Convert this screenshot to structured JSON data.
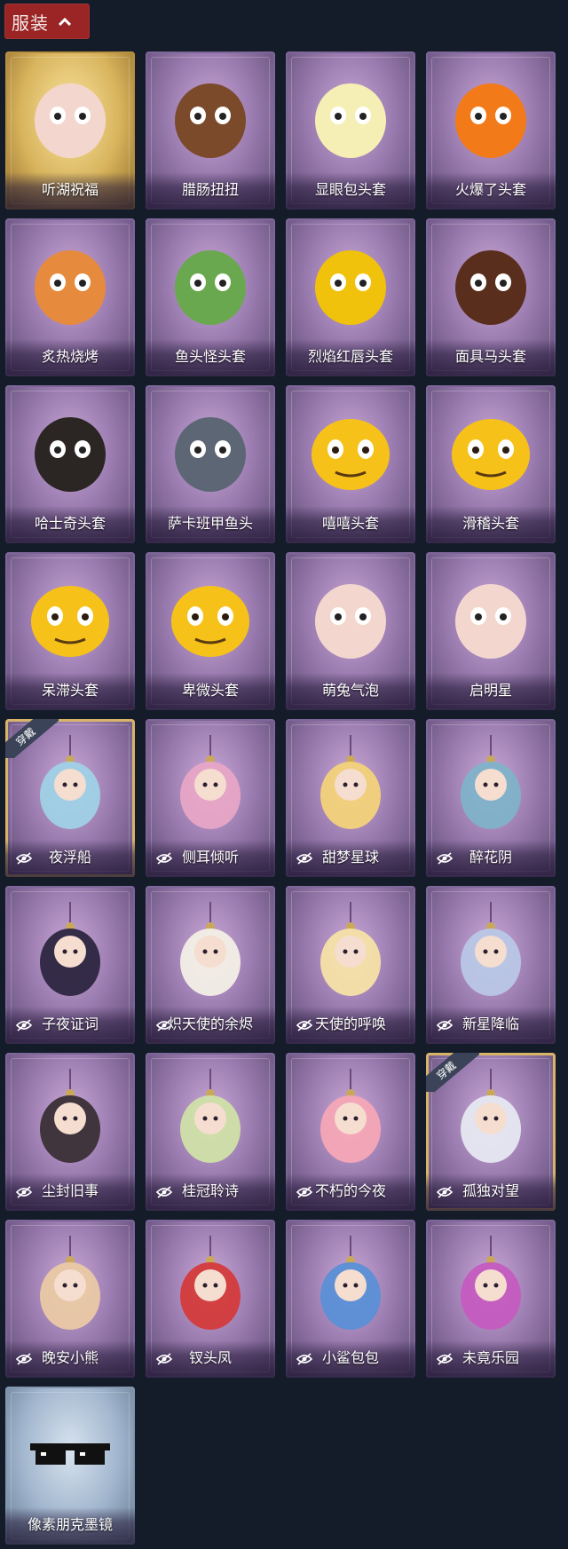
{
  "header": {
    "label": "服装"
  },
  "worn_label": "穿戴",
  "items": [
    {
      "name": "听湖祝福",
      "icon": "bald-doll-wings-icon",
      "frame": "gold",
      "hidden": false,
      "worn": false,
      "art_color": "#f3d7cf"
    },
    {
      "name": "腊肠扭扭",
      "icon": "dachshund-head-icon",
      "frame": "purple",
      "hidden": false,
      "worn": false,
      "art_color": "#7b4a2b"
    },
    {
      "name": "显眼包头套",
      "icon": "lightbulb-head-icon",
      "frame": "purple",
      "hidden": false,
      "worn": false,
      "art_color": "#f6efb5"
    },
    {
      "name": "火爆了头套",
      "icon": "fire-head-icon",
      "frame": "purple",
      "hidden": false,
      "worn": false,
      "art_color": "#f27a19"
    },
    {
      "name": "炙热烧烤",
      "icon": "grill-meat-head-icon",
      "frame": "purple",
      "hidden": false,
      "worn": false,
      "art_color": "#e68a3d"
    },
    {
      "name": "鱼头怪头套",
      "icon": "fish-head-mask-icon",
      "frame": "purple",
      "hidden": false,
      "worn": false,
      "art_color": "#6aa84f"
    },
    {
      "name": "烈焰红唇头套",
      "icon": "yellow-mouse-mask-icon",
      "frame": "purple",
      "hidden": false,
      "worn": false,
      "art_color": "#f0c20b"
    },
    {
      "name": "面具马头套",
      "icon": "horse-mask-icon",
      "frame": "purple",
      "hidden": false,
      "worn": false,
      "art_color": "#5a2e1c"
    },
    {
      "name": "哈士奇头套",
      "icon": "husky-head-icon",
      "frame": "purple",
      "hidden": false,
      "worn": false,
      "art_color": "#2b2624"
    },
    {
      "name": "萨卡班甲鱼头",
      "icon": "sacabambaspis-head-icon",
      "frame": "purple",
      "hidden": false,
      "worn": false,
      "art_color": "#5d6675"
    },
    {
      "name": "嘻嘻头套",
      "icon": "grin-emoji-icon",
      "frame": "purple",
      "hidden": false,
      "worn": false,
      "art_color": "#f6c219"
    },
    {
      "name": "滑稽头套",
      "icon": "smirk-emoji-icon",
      "frame": "purple",
      "hidden": false,
      "worn": false,
      "art_color": "#f6c219"
    },
    {
      "name": "呆滞头套",
      "icon": "flushed-emoji-icon",
      "frame": "purple",
      "hidden": false,
      "worn": false,
      "art_color": "#f6c219"
    },
    {
      "name": "卑微头套",
      "icon": "pleading-emoji-icon",
      "frame": "purple",
      "hidden": false,
      "worn": false,
      "art_color": "#f6c219"
    },
    {
      "name": "萌兔气泡",
      "icon": "bald-doll-bubbles-icon",
      "frame": "purple",
      "hidden": false,
      "worn": false,
      "art_color": "#f3d7cf"
    },
    {
      "name": "启明星",
      "icon": "bald-doll-star-icon",
      "frame": "purple",
      "hidden": false,
      "worn": false,
      "art_color": "#f3d7cf"
    },
    {
      "name": "夜浮船",
      "icon": "jellyfish-charm-icon",
      "frame": "purple",
      "hidden": true,
      "worn": true,
      "art_color": "#9fd1e6"
    },
    {
      "name": "侧耳倾听",
      "icon": "lotus-wreath-charm-icon",
      "frame": "purple",
      "hidden": true,
      "worn": false,
      "art_color": "#e7a5c6"
    },
    {
      "name": "甜梦星球",
      "icon": "moon-fox-charm-icon",
      "frame": "purple",
      "hidden": true,
      "worn": false,
      "art_color": "#f2d27a"
    },
    {
      "name": "醉花阴",
      "icon": "flower-lantern-charm-icon",
      "frame": "purple",
      "hidden": true,
      "worn": false,
      "art_color": "#7fb2c9"
    },
    {
      "name": "子夜证词",
      "icon": "plague-doctor-charm-icon",
      "frame": "purple",
      "hidden": true,
      "worn": false,
      "art_color": "#2c2640"
    },
    {
      "name": "炽天使的余烬",
      "icon": "angel-doll-charm-icon",
      "frame": "purple",
      "hidden": true,
      "worn": false,
      "art_color": "#f3efe6"
    },
    {
      "name": "天使的呼唤",
      "icon": "cherub-doll-charm-icon",
      "frame": "purple",
      "hidden": true,
      "worn": false,
      "art_color": "#f5e1a8"
    },
    {
      "name": "新星降临",
      "icon": "star-doll-charm-icon",
      "frame": "purple",
      "hidden": true,
      "worn": false,
      "art_color": "#b9c7e6"
    },
    {
      "name": "尘封旧事",
      "icon": "gentleman-doll-charm-icon",
      "frame": "purple",
      "hidden": true,
      "worn": false,
      "art_color": "#3a2f36"
    },
    {
      "name": "桂冠聆诗",
      "icon": "laurel-doll-charm-icon",
      "frame": "purple",
      "hidden": true,
      "worn": false,
      "art_color": "#cfe0a8"
    },
    {
      "name": "不朽的今夜",
      "icon": "sundae-fox-charm-icon",
      "frame": "purple",
      "hidden": true,
      "worn": false,
      "art_color": "#f4a6b6"
    },
    {
      "name": "孤独对望",
      "icon": "white-hair-doll-charm-icon",
      "frame": "purple",
      "hidden": true,
      "worn": true,
      "art_color": "#e6e8f2"
    },
    {
      "name": "晚安小熊",
      "icon": "bear-charm-icon",
      "frame": "purple",
      "hidden": true,
      "worn": false,
      "art_color": "#e9c9a4"
    },
    {
      "name": "钗头凤",
      "icon": "phoenix-crown-doll-charm-icon",
      "frame": "purple",
      "hidden": true,
      "worn": false,
      "art_color": "#d33b3b"
    },
    {
      "name": "小鲨包包",
      "icon": "shark-bag-charm-icon",
      "frame": "purple",
      "hidden": true,
      "worn": false,
      "art_color": "#5b8fd6"
    },
    {
      "name": "未竟乐园",
      "icon": "clown-doll-charm-icon",
      "frame": "purple",
      "hidden": true,
      "worn": false,
      "art_color": "#c45cc0"
    },
    {
      "name": "像素朋克墨镜",
      "icon": "pixel-sunglasses-icon",
      "frame": "blue",
      "hidden": false,
      "worn": false,
      "art_color": "#111111"
    }
  ]
}
